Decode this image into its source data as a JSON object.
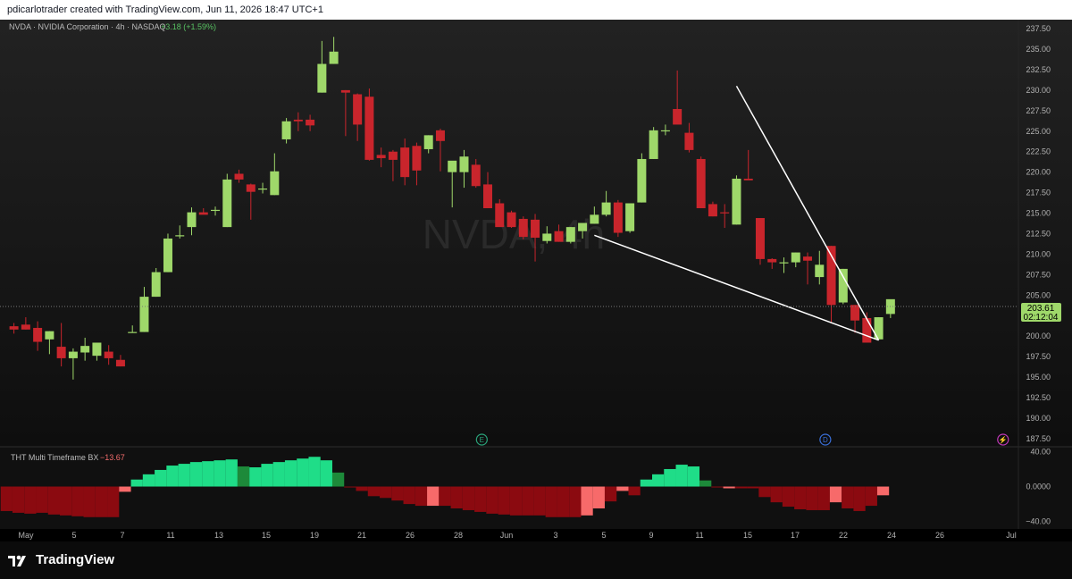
{
  "caption": "pdicarlotrader created with TradingView.com, Jun 11, 2026 18:47 UTC+1",
  "header": {
    "symbol_desc": "NVDA · NVIDIA Corporation · 4h · NASDAQ",
    "change": "+3.18 (+1.59%)",
    "watermark": "NVDA, 4h"
  },
  "price_badge": {
    "price": "203.61",
    "countdown": "02:12:04"
  },
  "indicator": {
    "name": "THT Multi Timeframe BX",
    "value": "−13.67",
    "axis_labels": [
      "40.00",
      "0.0000",
      "−40.00"
    ]
  },
  "event_markers": [
    {
      "label": "E",
      "name": "earnings-marker-icon",
      "after_index": 39
    },
    {
      "label": "D",
      "name": "dividend-marker-icon",
      "after_index": 68
    },
    {
      "label": "⚡",
      "name": "split-marker-icon",
      "after_index": 83
    }
  ],
  "x_axis_labels": [
    "May",
    "5",
    "7",
    "11",
    "13",
    "15",
    "19",
    "21",
    "26",
    "28",
    "Jun",
    "3",
    "5",
    "9",
    "11",
    "15",
    "17",
    "22",
    "24",
    "26",
    "Jul"
  ],
  "brand": {
    "name": "TradingView"
  },
  "colors": {
    "up": "#9fd86a",
    "down": "#c9252c",
    "osc_bright_up": "#1fdd88",
    "osc_dark_up": "#1d8a3a",
    "osc_bright_down": "#f76a6a",
    "osc_dark_down": "#8b0a10"
  },
  "chart_data": {
    "type": "candlestick",
    "y_axis": {
      "ticks": [
        "237.50",
        "235.00",
        "232.50",
        "230.00",
        "227.50",
        "225.00",
        "222.50",
        "220.00",
        "217.50",
        "215.00",
        "212.50",
        "210.00",
        "207.50",
        "205.00",
        "202.50",
        "200.00",
        "197.50",
        "195.00",
        "192.50",
        "190.00",
        "187.50"
      ],
      "range": [
        186.5,
        238.6
      ]
    },
    "last_price": 203.61,
    "candles": [
      [
        201.2,
        201.6,
        200.3,
        200.8
      ],
      [
        201.4,
        202.3,
        200.8,
        200.8
      ],
      [
        201.0,
        201.8,
        198.2,
        199.3
      ],
      [
        199.6,
        200.6,
        197.8,
        200.6
      ],
      [
        198.7,
        201.6,
        196.3,
        197.3
      ],
      [
        197.3,
        198.5,
        194.7,
        198.1
      ],
      [
        198.0,
        199.8,
        197.0,
        198.8
      ],
      [
        197.6,
        199.2,
        197.0,
        199.2
      ],
      [
        198.1,
        198.9,
        196.5,
        197.3
      ],
      [
        197.1,
        197.7,
        196.3,
        196.3
      ],
      [
        200.5,
        201.3,
        200.5,
        200.5
      ],
      [
        200.5,
        206.0,
        200.5,
        204.8
      ],
      [
        204.8,
        208.3,
        204.8,
        207.8
      ],
      [
        207.8,
        212.5,
        207.8,
        211.9
      ],
      [
        212.3,
        213.5,
        211.9,
        212.3
      ],
      [
        213.3,
        215.7,
        212.3,
        215.1
      ],
      [
        215.1,
        215.6,
        214.9,
        214.8
      ],
      [
        215.4,
        215.8,
        214.7,
        215.4
      ],
      [
        213.3,
        219.8,
        213.3,
        219.1
      ],
      [
        219.8,
        220.3,
        218.7,
        219.1
      ],
      [
        218.5,
        218.6,
        214.2,
        217.6
      ],
      [
        218.0,
        218.7,
        217.4,
        218.0
      ],
      [
        217.2,
        222.3,
        217.2,
        220.1
      ],
      [
        224.0,
        226.6,
        223.5,
        226.2
      ],
      [
        226.4,
        227.3,
        225.0,
        226.2
      ],
      [
        226.4,
        227.0,
        225.0,
        225.7
      ],
      [
        229.7,
        236.0,
        229.7,
        233.2
      ],
      [
        233.2,
        236.5,
        233.2,
        234.7
      ],
      [
        230.0,
        230.0,
        224.4,
        229.7
      ],
      [
        229.5,
        229.6,
        223.8,
        225.8
      ],
      [
        229.2,
        230.2,
        221.4,
        221.5
      ],
      [
        222.1,
        223.0,
        220.6,
        221.7
      ],
      [
        222.5,
        222.7,
        218.9,
        221.5
      ],
      [
        223.0,
        224.1,
        218.4,
        219.4
      ],
      [
        223.2,
        223.6,
        218.4,
        220.2
      ],
      [
        222.8,
        224.5,
        222.3,
        224.5
      ],
      [
        225.1,
        225.3,
        220.1,
        223.8
      ],
      [
        220.0,
        220.7,
        215.7,
        221.4
      ],
      [
        220.0,
        222.7,
        218.1,
        221.9
      ],
      [
        220.9,
        221.6,
        218.1,
        218.3
      ],
      [
        218.5,
        220.0,
        216.0,
        215.6
      ],
      [
        216.2,
        216.7,
        214.9,
        213.3
      ],
      [
        215.1,
        215.3,
        213.2,
        213.3
      ],
      [
        214.3,
        214.6,
        211.8,
        212.1
      ],
      [
        214.2,
        214.9,
        209.1,
        212.0
      ],
      [
        211.6,
        213.4,
        211.3,
        212.5
      ],
      [
        212.8,
        213.6,
        211.5,
        211.5
      ],
      [
        211.5,
        213.3,
        211.3,
        213.3
      ],
      [
        212.8,
        213.7,
        211.9,
        213.8
      ],
      [
        213.7,
        215.8,
        213.7,
        214.8
      ],
      [
        214.8,
        217.7,
        214.6,
        216.3
      ],
      [
        216.3,
        216.6,
        212.1,
        212.6
      ],
      [
        212.8,
        216.2,
        212.6,
        216.2
      ],
      [
        216.3,
        222.3,
        216.3,
        221.6
      ],
      [
        221.6,
        225.5,
        221.6,
        225.1
      ],
      [
        225.0,
        225.8,
        224.5,
        225.1
      ],
      [
        227.7,
        232.4,
        227.4,
        225.8
      ],
      [
        224.8,
        226.0,
        222.4,
        222.7
      ],
      [
        221.6,
        221.9,
        216.1,
        215.6
      ],
      [
        216.1,
        216.4,
        214.6,
        214.6
      ],
      [
        215.1,
        216.1,
        213.2,
        215.0
      ],
      [
        213.6,
        219.6,
        213.6,
        219.2
      ],
      [
        219.2,
        222.7,
        219.1,
        219.0
      ],
      [
        214.4,
        214.4,
        208.7,
        209.4
      ],
      [
        209.4,
        209.5,
        208.2,
        209.0
      ],
      [
        209.0,
        209.6,
        207.7,
        209.0
      ],
      [
        209.0,
        210.2,
        208.4,
        210.2
      ],
      [
        209.7,
        210.2,
        206.3,
        209.2
      ],
      [
        207.2,
        210.4,
        206.3,
        208.7
      ],
      [
        211.0,
        211.0,
        201.7,
        203.8
      ],
      [
        204.1,
        208.2,
        203.9,
        208.2
      ],
      [
        203.8,
        203.8,
        200.4,
        201.9
      ],
      [
        202.2,
        202.9,
        199.7,
        199.2
      ],
      [
        199.6,
        202.3,
        199.7,
        202.3
      ],
      [
        202.7,
        204.3,
        202.2,
        204.5
      ]
    ],
    "trendlines": [
      {
        "from_index": 61,
        "from_price": 230.5,
        "to_index": 73,
        "to_price": 199.5
      },
      {
        "from_index": 49,
        "from_price": 212.3,
        "to_index": 73,
        "to_price": 199.5
      }
    ],
    "oscillator": {
      "name": "THT Multi Timeframe BX",
      "range": [
        -48.5,
        45.5
      ],
      "bars": [
        [
          -28,
          "dd"
        ],
        [
          -30,
          "dd"
        ],
        [
          -31,
          "dd"
        ],
        [
          -30,
          "dd"
        ],
        [
          -32,
          "dd"
        ],
        [
          -33,
          "dd"
        ],
        [
          -34,
          "dd"
        ],
        [
          -35,
          "dd"
        ],
        [
          -35,
          "dd"
        ],
        [
          -35,
          "dd"
        ],
        [
          -6,
          "bd"
        ],
        [
          8,
          "bu"
        ],
        [
          14,
          "bu"
        ],
        [
          19,
          "bu"
        ],
        [
          24,
          "bu"
        ],
        [
          26,
          "bu"
        ],
        [
          28,
          "bu"
        ],
        [
          29,
          "bu"
        ],
        [
          30,
          "bu"
        ],
        [
          31,
          "bu"
        ],
        [
          23,
          "du"
        ],
        [
          22,
          "bu"
        ],
        [
          26,
          "bu"
        ],
        [
          28,
          "bu"
        ],
        [
          30,
          "bu"
        ],
        [
          32,
          "bu"
        ],
        [
          34,
          "bu"
        ],
        [
          30,
          "bu"
        ],
        [
          16,
          "du"
        ],
        [
          -1,
          "dd"
        ],
        [
          -5,
          "dd"
        ],
        [
          -11,
          "dd"
        ],
        [
          -13,
          "dd"
        ],
        [
          -16,
          "dd"
        ],
        [
          -20,
          "dd"
        ],
        [
          -22,
          "dd"
        ],
        [
          -22,
          "bd"
        ],
        [
          -22,
          "dd"
        ],
        [
          -25,
          "dd"
        ],
        [
          -27,
          "dd"
        ],
        [
          -29,
          "dd"
        ],
        [
          -31,
          "dd"
        ],
        [
          -32,
          "dd"
        ],
        [
          -33,
          "dd"
        ],
        [
          -33,
          "dd"
        ],
        [
          -33,
          "dd"
        ],
        [
          -35,
          "dd"
        ],
        [
          -35,
          "dd"
        ],
        [
          -35,
          "dd"
        ],
        [
          -33,
          "bd"
        ],
        [
          -25,
          "bd"
        ],
        [
          -17,
          "dd"
        ],
        [
          -5,
          "bd"
        ],
        [
          -10,
          "dd"
        ],
        [
          8,
          "bu"
        ],
        [
          14,
          "bu"
        ],
        [
          20,
          "bu"
        ],
        [
          25,
          "bu"
        ],
        [
          23,
          "bu"
        ],
        [
          7,
          "du"
        ],
        [
          -1,
          "dd"
        ],
        [
          -2,
          "bd"
        ],
        [
          -2,
          "dd"
        ],
        [
          -2,
          "dd"
        ],
        [
          -12,
          "dd"
        ],
        [
          -18,
          "dd"
        ],
        [
          -23,
          "dd"
        ],
        [
          -26,
          "dd"
        ],
        [
          -27,
          "dd"
        ],
        [
          -27,
          "dd"
        ],
        [
          -18,
          "bd"
        ],
        [
          -25,
          "dd"
        ],
        [
          -28,
          "dd"
        ],
        [
          -22,
          "dd"
        ],
        [
          -10,
          "bd"
        ]
      ]
    }
  }
}
